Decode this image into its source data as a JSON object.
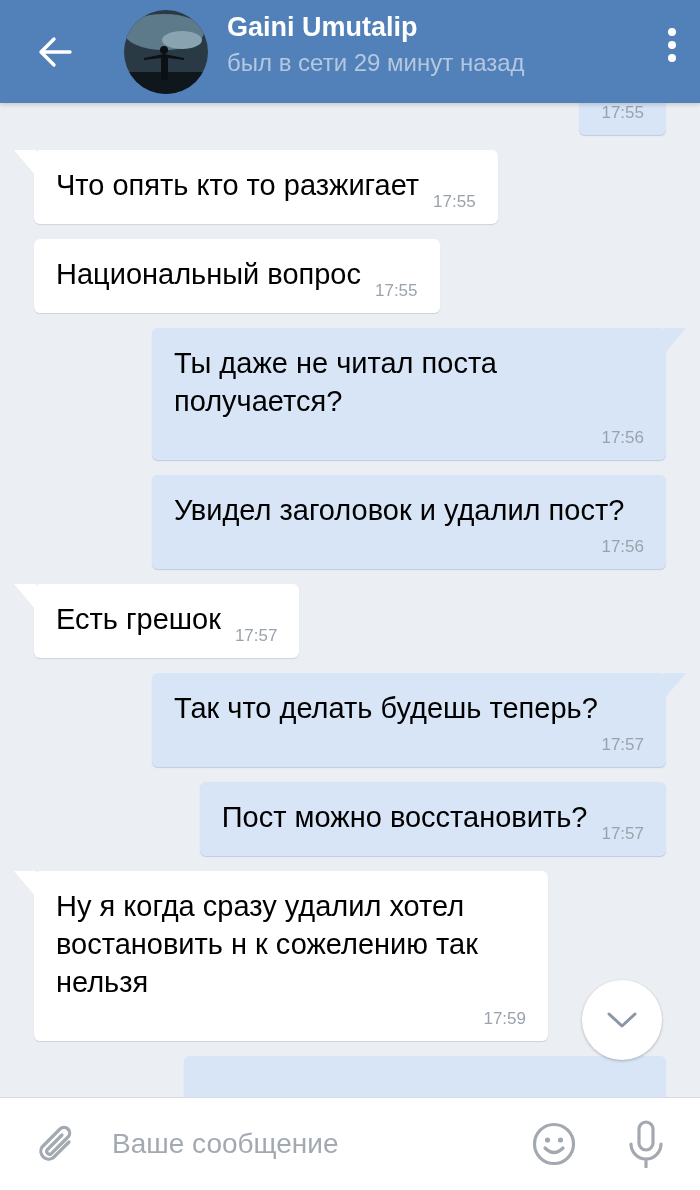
{
  "header": {
    "name": "Gaini Umutalip",
    "status": "был в сети 29 минут назад"
  },
  "messages": [
    {
      "kind": "outgoing",
      "tail": false,
      "time": "17:55"
    },
    {
      "kind": "incoming",
      "tail": true,
      "text": "Что опять кто то разжигает",
      "time": "17:55"
    },
    {
      "kind": "incoming",
      "tail": false,
      "text": "Национальный вопрос",
      "time": "17:55"
    },
    {
      "kind": "outgoing",
      "tail": true,
      "text": "Ты даже не читал поста получается?",
      "time": "17:56"
    },
    {
      "kind": "outgoing",
      "tail": false,
      "text": "Увидел заголовок и удалил пост?",
      "time": "17:56"
    },
    {
      "kind": "incoming",
      "tail": true,
      "text": "Есть грешок",
      "time": "17:57"
    },
    {
      "kind": "outgoing",
      "tail": true,
      "text": "Так что делать будешь теперь?",
      "time": "17:57"
    },
    {
      "kind": "outgoing",
      "tail": false,
      "text": "Пост можно восстановить?",
      "time": "17:57"
    },
    {
      "kind": "incoming",
      "tail": true,
      "text": "Ну я когда сразу удалил хотел востановить н к сожелению так нельзя",
      "time": "17:59"
    },
    {
      "kind": "outgoing",
      "tail": false
    }
  ],
  "composer": {
    "placeholder": "Ваше сообщение"
  }
}
